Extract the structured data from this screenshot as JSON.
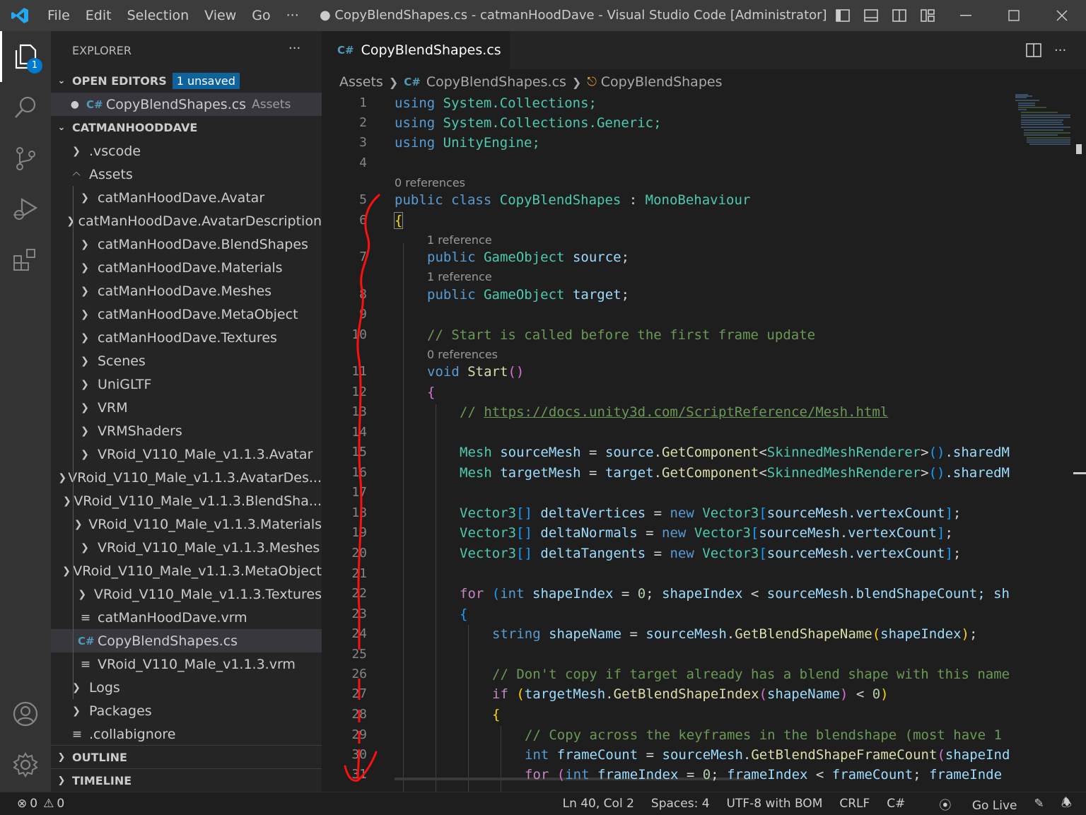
{
  "titlebar": {
    "menu": [
      "File",
      "Edit",
      "Selection",
      "View",
      "Go",
      "···"
    ],
    "window_title": "● CopyBlendShapes.cs - catmanHoodDave - Visual Studio Code [Administrator]"
  },
  "activity_bar": {
    "explorer_badge": "1"
  },
  "sidebar": {
    "title": "EXPLORER",
    "more": "···",
    "open_editors": {
      "label": "OPEN EDITORS",
      "badge": "1 unsaved",
      "item": {
        "name": "CopyBlendShapes.cs",
        "folder": "Assets"
      }
    },
    "workspace": {
      "label": "CATMANHOODDAVE",
      "items": [
        {
          "label": ".vscode",
          "kind": "folder",
          "depth": 1
        },
        {
          "label": "Assets",
          "kind": "folder-open",
          "depth": 1
        },
        {
          "label": "catManHoodDave.Avatar",
          "kind": "folder",
          "depth": 2
        },
        {
          "label": "catManHoodDave.AvatarDescription",
          "kind": "folder",
          "depth": 2
        },
        {
          "label": "catManHoodDave.BlendShapes",
          "kind": "folder",
          "depth": 2
        },
        {
          "label": "catManHoodDave.Materials",
          "kind": "folder",
          "depth": 2
        },
        {
          "label": "catManHoodDave.Meshes",
          "kind": "folder",
          "depth": 2
        },
        {
          "label": "catManHoodDave.MetaObject",
          "kind": "folder",
          "depth": 2
        },
        {
          "label": "catManHoodDave.Textures",
          "kind": "folder",
          "depth": 2
        },
        {
          "label": "Scenes",
          "kind": "folder",
          "depth": 2
        },
        {
          "label": "UniGLTF",
          "kind": "folder",
          "depth": 2
        },
        {
          "label": "VRM",
          "kind": "folder",
          "depth": 2
        },
        {
          "label": "VRMShaders",
          "kind": "folder",
          "depth": 2
        },
        {
          "label": "VRoid_V110_Male_v1.1.3.Avatar",
          "kind": "folder",
          "depth": 2
        },
        {
          "label": "VRoid_V110_Male_v1.1.3.AvatarDes...",
          "kind": "folder",
          "depth": 2
        },
        {
          "label": "VRoid_V110_Male_v1.1.3.BlendSha...",
          "kind": "folder",
          "depth": 2
        },
        {
          "label": "VRoid_V110_Male_v1.1.3.Materials",
          "kind": "folder",
          "depth": 2
        },
        {
          "label": "VRoid_V110_Male_v1.1.3.Meshes",
          "kind": "folder",
          "depth": 2
        },
        {
          "label": "VRoid_V110_Male_v1.1.3.MetaObject",
          "kind": "folder",
          "depth": 2
        },
        {
          "label": "VRoid_V110_Male_v1.1.3.Textures",
          "kind": "folder",
          "depth": 2
        },
        {
          "label": "catManHoodDave.vrm",
          "kind": "text",
          "depth": 2
        },
        {
          "label": "CopyBlendShapes.cs",
          "kind": "cs",
          "depth": 2,
          "selected": true
        },
        {
          "label": "VRoid_V110_Male_v1.1.3.vrm",
          "kind": "text",
          "depth": 2
        },
        {
          "label": "Logs",
          "kind": "folder",
          "depth": 1
        },
        {
          "label": "Packages",
          "kind": "folder",
          "depth": 1
        },
        {
          "label": ".collabignore",
          "kind": "text",
          "depth": 1
        }
      ]
    },
    "outline": "OUTLINE",
    "timeline": "TIMELINE"
  },
  "editor": {
    "tab": {
      "label": "CopyBlendShapes.cs"
    },
    "breadcrumbs": [
      "Assets",
      "CopyBlendShapes.cs",
      "CopyBlendShapes"
    ],
    "codelens": {
      "class_refs": "0 references",
      "source_refs": "1 reference",
      "target_refs": "1 reference",
      "start_refs": "0 references"
    },
    "line_numbers": [
      "1",
      "2",
      "3",
      "4",
      "5",
      "6",
      "7",
      "8",
      "9",
      "10",
      "11",
      "12",
      "13",
      "14",
      "15",
      "16",
      "17",
      "18",
      "19",
      "20",
      "21",
      "22",
      "23",
      "24",
      "25",
      "26",
      "27",
      "28",
      "29",
      "30",
      "31"
    ],
    "code": {
      "l1_kw": "using",
      "l1_rest": "System.Collections;",
      "l2_kw": "using",
      "l2_rest": "System.Collections.Generic;",
      "l3_kw": "using",
      "l3_rest": "UnityEngine;",
      "l5_public": "public",
      "l5_class": "class",
      "l5_name": "CopyBlendShapes",
      "l5_colon": " : ",
      "l5_base": "MonoBehaviour",
      "l6_brace": "{",
      "l7_public": "public",
      "l7_type": "GameObject",
      "l7_var": "source",
      "l7_semi": ";",
      "l8_public": "public",
      "l8_type": "GameObject",
      "l8_var": "target",
      "l8_semi": ";",
      "l10_comment": "// Start is called before the first frame update",
      "l11_void": "void",
      "l11_fn": "Start",
      "l11_paren": "()",
      "l12_brace": "{",
      "l13_slash": "// ",
      "l13_link": "https://docs.unity3d.com/ScriptReference/Mesh.html",
      "l15_type": "Mesh",
      "l15_var": "sourceMesh",
      "l15_eq": " = ",
      "l15_obj": "source",
      "l15_dot": ".",
      "l15_fn": "GetComponent",
      "l15_lt": "<",
      "l15_gen": "SkinnedMeshRenderer",
      "l15_gt": ">",
      "l15_paren": "()",
      "l15_tail": ".sharedM",
      "l16_type": "Mesh",
      "l16_var": "targetMesh",
      "l16_eq": " = ",
      "l16_obj": "target",
      "l16_dot": ".",
      "l16_fn": "GetComponent",
      "l16_lt": "<",
      "l16_gen": "SkinnedMeshRenderer",
      "l16_gt": ">",
      "l16_paren": "()",
      "l16_tail": ".sharedM",
      "l18_type": "Vector3",
      "l18_br": "[]",
      "l18_var": "deltaVertices",
      "l18_eq": " = ",
      "l18_new": "new",
      "l18_t2": "Vector3",
      "l18_ob": "[",
      "l18_expr": "sourceMesh.vertexCount",
      "l18_cb": "]",
      "l18_semi": ";",
      "l19_type": "Vector3",
      "l19_br": "[]",
      "l19_var": "deltaNormals",
      "l19_eq": " = ",
      "l19_new": "new",
      "l19_t2": "Vector3",
      "l19_ob": "[",
      "l19_expr": "sourceMesh.vertexCount",
      "l19_cb": "]",
      "l19_semi": ";",
      "l20_type": "Vector3",
      "l20_br": "[]",
      "l20_var": "deltaTangents",
      "l20_eq": " = ",
      "l20_new": "new",
      "l20_t2": "Vector3",
      "l20_ob": "[",
      "l20_expr": "sourceMesh.vertexCount",
      "l20_cb": "]",
      "l20_semi": ";",
      "l22_for": "for",
      "l22_op": " (",
      "l22_int": "int",
      "l22_v": "shapeIndex",
      "l22_eq": " = ",
      "l22_zero": "0",
      "l22_semi": "; ",
      "l22_v2": "shapeIndex",
      "l22_lt": " < ",
      "l22_v3": "sourceMesh.blendShapeCount",
      "l22_tail": "; sh",
      "l23_brace": "{",
      "l24_type": "string",
      "l24_var": "shapeName",
      "l24_eq": " = ",
      "l24_obj": "sourceMesh",
      "l24_dot": ".",
      "l24_fn": "GetBlendShapeName",
      "l24_op": "(",
      "l24_arg": "shapeIndex",
      "l24_cp": ")",
      "l24_semi": ";",
      "l26_comment": "// Don't copy if target already has a blend shape with this name",
      "l27_if": "if",
      "l27_op": " (",
      "l27_obj": "targetMesh",
      "l27_dot": ".",
      "l27_fn": "GetBlendShapeIndex",
      "l27_p": "(",
      "l27_arg": "shapeName",
      "l27_cp": ")",
      "l27_lt": " < ",
      "l27_zero": "0",
      "l27_close": ")",
      "l28_brace": "{",
      "l29_comment": "// Copy across the keyframes in the blendshape (most have 1",
      "l30_int": "int",
      "l30_var": "frameCount",
      "l30_eq": " = ",
      "l30_obj": "sourceMesh",
      "l30_dot": ".",
      "l30_fn": "GetBlendShapeFrameCount",
      "l30_p": "(",
      "l30_arg": "shapeInd",
      "l31_for": "for",
      "l31_op": " (",
      "l31_int": "int",
      "l31_v": "frameIndex",
      "l31_eq": " = ",
      "l31_zero": "0",
      "l31_semi": "; ",
      "l31_v2": "frameIndex",
      "l31_lt": " < ",
      "l31_v3": "frameCount",
      "l31_s2": "; ",
      "l31_v4": "frameInde"
    }
  },
  "statusbar": {
    "errors": "0",
    "warnings": "0",
    "position": "Ln 40, Col 2",
    "spaces": "Spaces: 4",
    "encoding": "UTF-8 with BOM",
    "eol": "CRLF",
    "language": "C#",
    "golive": "Go Live"
  }
}
